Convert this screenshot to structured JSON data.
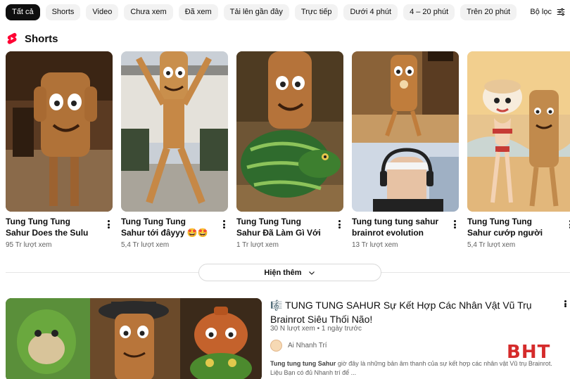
{
  "chips": [
    "Tất cả",
    "Shorts",
    "Video",
    "Chưa xem",
    "Đã xem",
    "Tải lên gần đây",
    "Trực tiếp",
    "Dưới 4 phút",
    "4 – 20 phút",
    "Trên 20 phút"
  ],
  "filter_label": "Bộ lọc",
  "shorts_section": {
    "title": "Shorts",
    "icon": "shorts-logo-icon",
    "accent": "#ff0033"
  },
  "shorts": [
    {
      "title": "Tung Tung Tung Sahur Does the Sulu Trend",
      "views": "95 Tr lượt xem"
    },
    {
      "title": "Tung Tung Tung Sahur tới đâyyy 🤩🤩🤩 ...",
      "views": "5,4 Tr lượt xem"
    },
    {
      "title": "Tung Tung Tung Sahur Đã Làm Gì Với Các ...",
      "views": "1 Tr lượt xem"
    },
    {
      "title": "Tung tung tung sahur brainrot evolution 💀...",
      "views": "13 Tr lượt xem"
    },
    {
      "title": "Tung Tung Tung Sahur cướp người yêu của ...",
      "views": "5,4 Tr lượt xem"
    }
  ],
  "show_more_label": "Hiện thêm",
  "video": {
    "title": "🎼 TUNG TUNG SAHUR Sự Kết Hợp Các Nhân Vật Vũ Trụ Brainrot Siêu Thối Não!",
    "meta": "30 N lượt xem • 1 ngày trước",
    "channel": "Ai Nhanh Trí",
    "desc_bold": "Tung tung tung Sahur",
    "desc_rest": " giờ đây là những bản âm thanh của sự kết hợp các nhân vật Vũ trụ Brainrot. Liệu Bạn có đủ Nhanh trí để ..."
  },
  "watermark": "BHT"
}
